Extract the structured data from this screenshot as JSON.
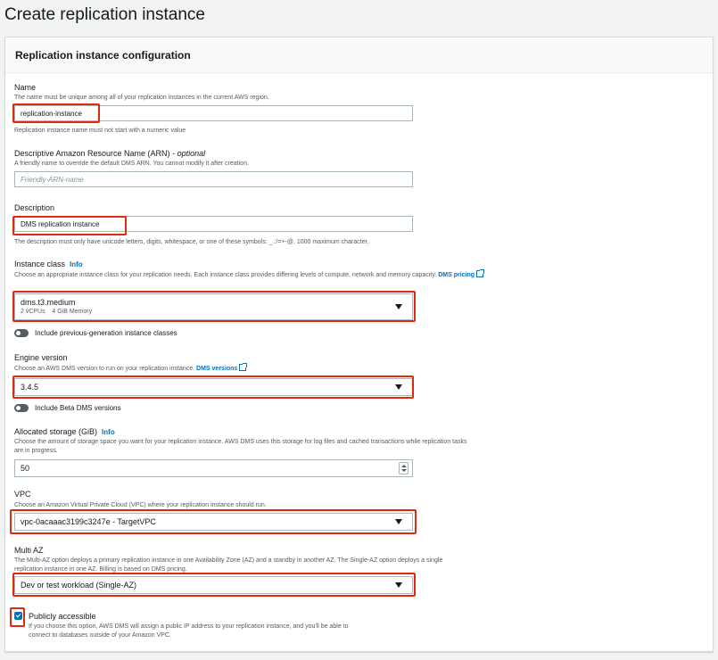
{
  "page_title": "Create replication instance",
  "panel_title": "Replication instance configuration",
  "name": {
    "label": "Name",
    "description": "The name must be unique among all of your replication instances in the current AWS region.",
    "value": "replication-instance",
    "constraint": "Replication instance name must not start with a numeric value"
  },
  "arn": {
    "label": "Descriptive Amazon Resource Name (ARN)",
    "optional": "optional",
    "description": "A friendly name to override the default DMS ARN. You cannot modify it after creation.",
    "placeholder": "Friendly-ARN-name"
  },
  "description_field": {
    "label": "Description",
    "value": "DMS replication instance",
    "constraint": "The description must only have unicode letters, digits, whitespace, or one of these symbols: _.:/=+-@. 1000 maximum character."
  },
  "instance_class": {
    "label": "Instance class",
    "info": "Info",
    "description": "Choose an appropriate instance class for your replication needs. Each instance class provides differing levels of compute, network and memory capacity.",
    "link_line1": "DMS",
    "link_line2": "pricing",
    "selected": "dms.t3.medium",
    "vcpus": "2 vCPUs",
    "memory": "4 GiB Memory",
    "toggle_label": "Include previous-generation instance classes"
  },
  "engine_version": {
    "label": "Engine version",
    "description": "Choose an AWS DMS version to run on your replication instance.",
    "link": "DMS versions",
    "selected": "3.4.5",
    "toggle_label": "Include Beta DMS versions"
  },
  "storage": {
    "label": "Allocated storage (GiB)",
    "info": "Info",
    "description_line1": "Choose the amount of storage space you want for your replication instance. AWS DMS uses this storage for log files and cached transactions while replication tasks",
    "description_line2": "are in progress.",
    "value": "50"
  },
  "vpc": {
    "label": "VPC",
    "description": "Choose an Amazon Virtual Private Cloud (VPC) where your replication instance should run.",
    "selected": "vpc-0acaaac3199c3247e - TargetVPC"
  },
  "multi_az": {
    "label": "Multi AZ",
    "description_line1": "The Multi-AZ option deploys a primary replication instance in one Availability Zone (AZ) and a standby in another AZ. The Single-AZ option deploys a single",
    "description_line2": "replication instance in one AZ. Billing is based on DMS pricing.",
    "selected": "Dev or test workload (Single-AZ)"
  },
  "public_access": {
    "label": "Publicly accessible",
    "description_line1": "If you choose this option, AWS DMS will assign a public IP address to your replication instance, and you'll be able to",
    "description_line2": "connect to databases outside of your Amazon VPC.",
    "checked": true
  },
  "colors": {
    "highlight": "#e02a0f",
    "link": "#0073bb",
    "checkbox": "#0073bb"
  }
}
